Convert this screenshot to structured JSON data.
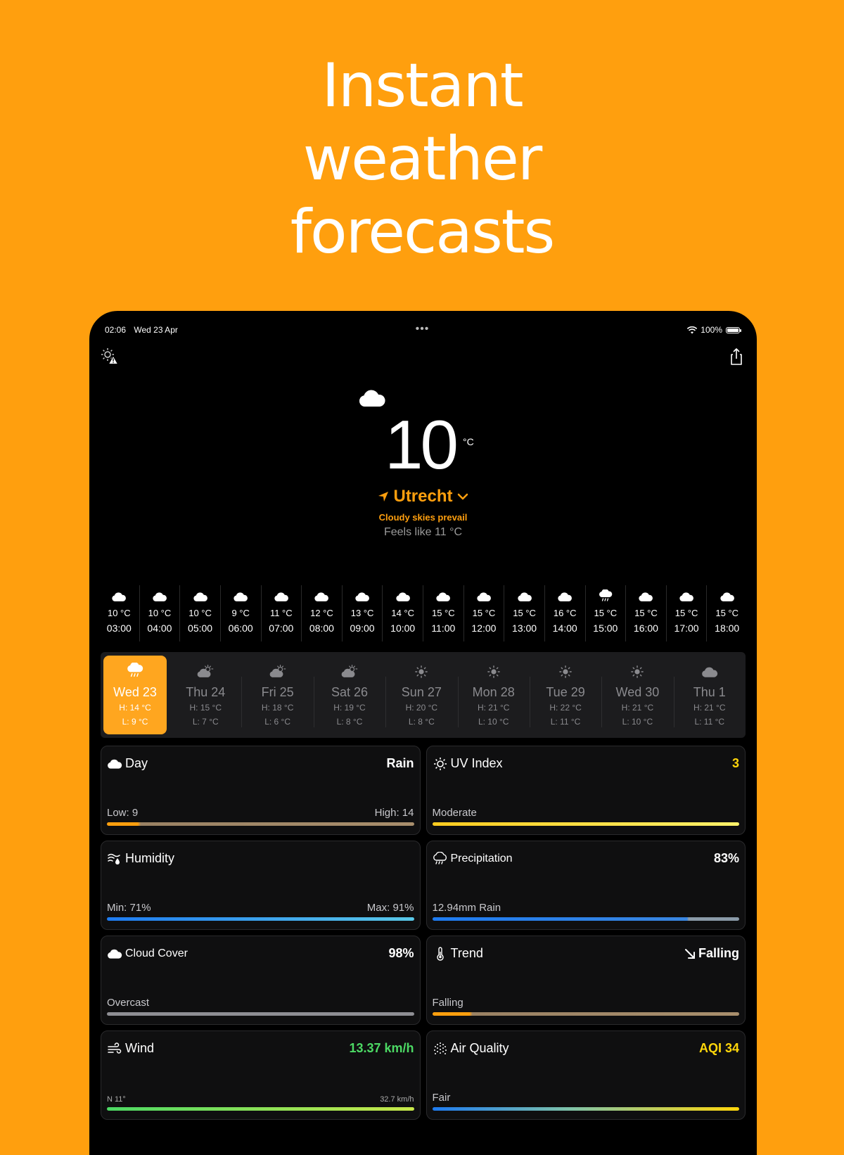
{
  "headline": [
    "Instant",
    "weather",
    "forecasts"
  ],
  "status": {
    "time": "02:06",
    "date": "Wed 23 Apr",
    "dots": "•••",
    "battery": "100%"
  },
  "hero": {
    "temp": "10",
    "unit": "°C",
    "location": "Utrecht",
    "condition": "Cloudy skies prevail",
    "feels_like": "Feels like  11 °C"
  },
  "hourly": [
    {
      "icon": "cloud-icon",
      "temp": "10 °C",
      "time": "03:00"
    },
    {
      "icon": "cloud-icon",
      "temp": "10 °C",
      "time": "04:00"
    },
    {
      "icon": "cloud-icon",
      "temp": "10 °C",
      "time": "05:00"
    },
    {
      "icon": "cloud-icon",
      "temp": "9 °C",
      "time": "06:00"
    },
    {
      "icon": "cloud-icon",
      "temp": "11 °C",
      "time": "07:00"
    },
    {
      "icon": "cloud-icon",
      "temp": "12 °C",
      "time": "08:00"
    },
    {
      "icon": "cloud-icon",
      "temp": "13 °C",
      "time": "09:00"
    },
    {
      "icon": "cloud-icon",
      "temp": "14 °C",
      "time": "10:00"
    },
    {
      "icon": "cloud-icon",
      "temp": "15 °C",
      "time": "11:00"
    },
    {
      "icon": "cloud-icon",
      "temp": "15 °C",
      "time": "12:00"
    },
    {
      "icon": "cloud-icon",
      "temp": "15 °C",
      "time": "13:00"
    },
    {
      "icon": "cloud-icon",
      "temp": "16 °C",
      "time": "14:00"
    },
    {
      "icon": "rain-cloud-icon",
      "temp": "15 °C",
      "time": "15:00"
    },
    {
      "icon": "cloud-icon",
      "temp": "15 °C",
      "time": "16:00"
    },
    {
      "icon": "cloud-icon",
      "temp": "15 °C",
      "time": "17:00"
    },
    {
      "icon": "cloud-icon",
      "temp": "15 °C",
      "time": "18:00"
    }
  ],
  "daily": [
    {
      "icon": "rain-cloud-icon",
      "name": "Wed 23",
      "high": "H: 14 °C",
      "low": "L: 9 °C",
      "selected": true
    },
    {
      "icon": "partly-cloudy-icon",
      "name": "Thu 24",
      "high": "H: 15 °C",
      "low": "L: 7 °C"
    },
    {
      "icon": "partly-cloudy-icon",
      "name": "Fri 25",
      "high": "H: 18 °C",
      "low": "L: 6 °C"
    },
    {
      "icon": "partly-cloudy-icon",
      "name": "Sat 26",
      "high": "H: 19 °C",
      "low": "L: 8 °C"
    },
    {
      "icon": "sun-icon",
      "name": "Sun 27",
      "high": "H: 20 °C",
      "low": "L: 8 °C"
    },
    {
      "icon": "sun-icon",
      "name": "Mon 28",
      "high": "H: 21 °C",
      "low": "L: 10 °C"
    },
    {
      "icon": "sun-icon",
      "name": "Tue 29",
      "high": "H: 22 °C",
      "low": "L: 11 °C"
    },
    {
      "icon": "sun-icon",
      "name": "Wed 30",
      "high": "H: 21 °C",
      "low": "L: 10 °C"
    },
    {
      "icon": "cloud-icon",
      "name": "Thu 1",
      "high": "H: 21 °C",
      "low": "L: 11 °C"
    }
  ],
  "cards": {
    "day": {
      "title": "Day",
      "value": "Rain",
      "sub_left": "Low: 9",
      "sub_right": "High: 14",
      "fill": 0.1
    },
    "uv": {
      "title": "UV Index",
      "value": "3",
      "sub_left": "Moderate",
      "sub_right": ""
    },
    "humidity": {
      "title": "Humidity",
      "value": "",
      "sub_left": "Min: 71%",
      "sub_right": "Max: 91%"
    },
    "precip": {
      "title": "Precipitation",
      "value": "83%",
      "sub_left": "12.94mm Rain",
      "sub_right": "",
      "fill": 0.83
    },
    "cloud": {
      "title": "Cloud Cover",
      "value": "98%",
      "sub_left": "Overcast",
      "sub_right": "",
      "fill": 0.98
    },
    "trend": {
      "title": "Trend",
      "value": "Falling",
      "sub_left": "Falling",
      "sub_right": "",
      "fill": 0.12
    },
    "wind": {
      "title": "Wind",
      "value": "13.37 km/h",
      "sub_left": "N 11°",
      "sub_right": "32.7 km/h"
    },
    "aqi": {
      "title": "Air Quality",
      "value": "AQI 34",
      "sub_left": "Fair",
      "sub_right": ""
    }
  },
  "colors": {
    "background": "#FF9F0E",
    "accent": "#FF9F0E",
    "uv_value": "#FFD60A",
    "wind_value": "#4CD964",
    "aqi_value": "#FFD60A"
  }
}
